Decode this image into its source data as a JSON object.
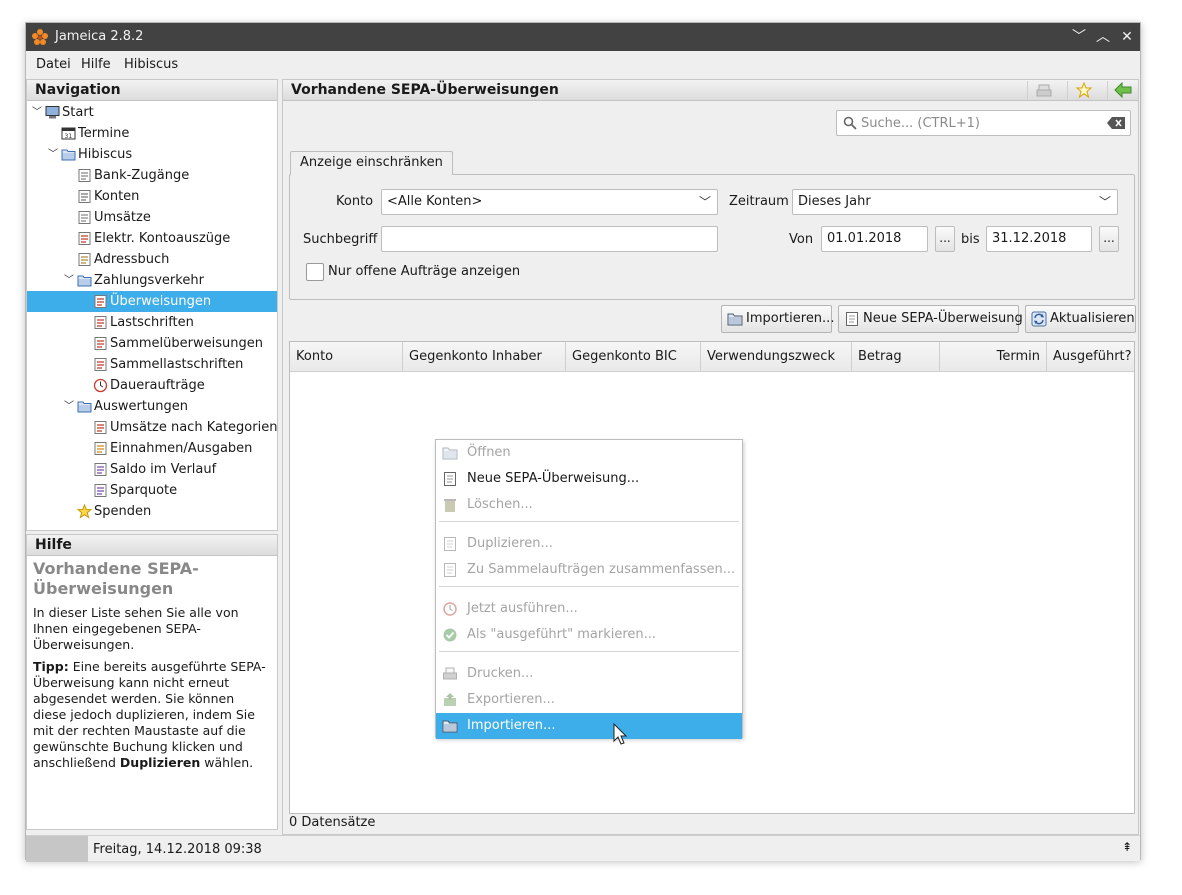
{
  "window": {
    "title": "Jameica 2.8.2"
  },
  "menu": [
    "Datei",
    "Hilfe",
    "Hibiscus"
  ],
  "navigation": {
    "title": "Navigation",
    "items": [
      {
        "label": "Start",
        "level": 0,
        "toggle": "v",
        "icon": "computer-icon"
      },
      {
        "label": "Termine",
        "level": 1,
        "toggle": "",
        "icon": "calendar-icon"
      },
      {
        "label": "Hibiscus",
        "level": 1,
        "toggle": "v",
        "icon": "folder-icon"
      },
      {
        "label": "Bank-Zugänge",
        "level": 2,
        "toggle": "",
        "icon": "users-icon"
      },
      {
        "label": "Konten",
        "level": 2,
        "toggle": "",
        "icon": "account-icon"
      },
      {
        "label": "Umsätze",
        "level": 2,
        "toggle": "",
        "icon": "transactions-icon"
      },
      {
        "label": "Elektr. Kontoauszüge",
        "level": 2,
        "toggle": "",
        "icon": "pdf-icon"
      },
      {
        "label": "Adressbuch",
        "level": 2,
        "toggle": "",
        "icon": "addressbook-icon"
      },
      {
        "label": "Zahlungsverkehr",
        "level": 2,
        "toggle": "v",
        "icon": "folder-icon"
      },
      {
        "label": "Überweisungen",
        "level": 3,
        "toggle": "",
        "icon": "transfer-icon",
        "selected": true
      },
      {
        "label": "Lastschriften",
        "level": 3,
        "toggle": "",
        "icon": "debit-icon"
      },
      {
        "label": "Sammelüberweisungen",
        "level": 3,
        "toggle": "",
        "icon": "batch-transfer-icon"
      },
      {
        "label": "Sammellastschriften",
        "level": 3,
        "toggle": "",
        "icon": "batch-debit-icon"
      },
      {
        "label": "Daueraufträge",
        "level": 3,
        "toggle": "",
        "icon": "clock-icon"
      },
      {
        "label": "Auswertungen",
        "level": 2,
        "toggle": "v",
        "icon": "folder-icon"
      },
      {
        "label": "Umsätze nach Kategorien",
        "level": 3,
        "toggle": "",
        "icon": "pie-chart-icon"
      },
      {
        "label": "Einnahmen/Ausgaben",
        "level": 3,
        "toggle": "",
        "icon": "arrows-icon"
      },
      {
        "label": "Saldo im Verlauf",
        "level": 3,
        "toggle": "",
        "icon": "line-chart-icon"
      },
      {
        "label": "Sparquote",
        "level": 3,
        "toggle": "",
        "icon": "savings-chart-icon"
      },
      {
        "label": "Spenden",
        "level": 2,
        "toggle": "",
        "icon": "star-icon"
      }
    ]
  },
  "help": {
    "title": "Hilfe",
    "heading": "Vorhandene SEPA-Überweisungen",
    "p1": "In dieser Liste sehen Sie alle von Ihnen eingegebenen SEPA-Überweisungen.",
    "tip_label": "Tipp:",
    "tip_text": " Eine bereits ausgeführte SEPA-Überweisung kann nicht erneut abgesendet werden. Sie können diese jedoch duplizieren, indem Sie mit der rechten Maustaste auf die gewünschte Buchung klicken und anschließend ",
    "tip_bold": "Duplizieren",
    "tip_end": " wählen."
  },
  "main": {
    "title": "Vorhandene SEPA-Überweisungen",
    "search_placeholder": "Suche...  (CTRL+1)",
    "filter_tab": "Anzeige einschränken",
    "konto_label": "Konto",
    "konto_value": "<Alle Konten>",
    "zeitraum_label": "Zeitraum",
    "zeitraum_value": "Dieses Jahr",
    "suchbegriff_label": "Suchbegriff",
    "suchbegriff_value": "",
    "von_label": "Von",
    "von_value": "01.01.2018",
    "bis_label": "bis",
    "bis_value": "31.12.2018",
    "dots": "...",
    "open_only_label": "Nur offene Aufträge anzeigen",
    "buttons": {
      "import": "Importieren...",
      "new": "Neue SEPA-Überweisung",
      "refresh": "Aktualisieren"
    },
    "columns": [
      "Konto",
      "Gegenkonto Inhaber",
      "Gegenkonto BIC",
      "Verwendungszweck",
      "Betrag",
      "Termin",
      "Ausgeführt?"
    ],
    "count": "0 Datensätze"
  },
  "context_menu": [
    {
      "label": "Öffnen",
      "disabled": true,
      "icon": "open-folder-icon"
    },
    {
      "label": "Neue SEPA-Überweisung...",
      "disabled": false,
      "icon": "document-icon"
    },
    {
      "label": "Löschen...",
      "disabled": true,
      "icon": "trash-icon"
    },
    {
      "label": "Duplizieren...",
      "disabled": true,
      "icon": "duplicate-icon"
    },
    {
      "label": "Zu Sammelaufträgen zusammenfassen...",
      "disabled": true,
      "icon": "batch-icon"
    },
    {
      "label": "Jetzt ausführen...",
      "disabled": true,
      "icon": "execute-icon"
    },
    {
      "label": "Als \"ausgeführt\" markieren...",
      "disabled": true,
      "icon": "check-icon"
    },
    {
      "label": "Drucken...",
      "disabled": true,
      "icon": "print-icon"
    },
    {
      "label": "Exportieren...",
      "disabled": true,
      "icon": "export-icon"
    },
    {
      "label": "Importieren...",
      "disabled": false,
      "icon": "import-icon",
      "highlighted": true
    }
  ],
  "status": {
    "datetime": "Freitag, 14.12.2018 09:38"
  }
}
